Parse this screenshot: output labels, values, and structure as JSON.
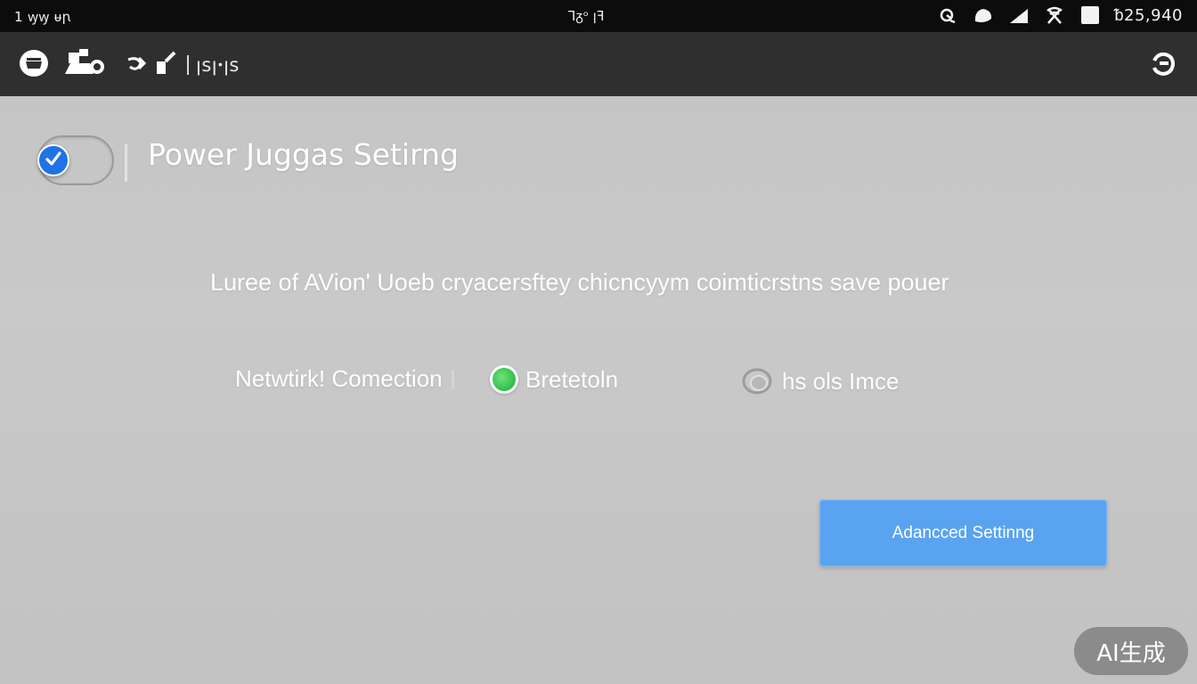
{
  "status_bar": {
    "left_text": "1 ꝡꝡ ᵾꞃ",
    "center_text": "Ꞁᵹᵒ ꞁꟻ",
    "right_value": "ᵬ25,940",
    "icons": [
      "alarm-icon",
      "chat-icon",
      "signal-icon",
      "wifi-off-icon",
      "battery-icon"
    ]
  },
  "app_bar": {
    "title": "ꞁsꞁꞏꞁs",
    "icons": [
      "home-icon",
      "profile-icon",
      "share-icon",
      "refresh-icon"
    ]
  },
  "main": {
    "toggle_checked": true,
    "title": "Power Juggas Setirng",
    "description": "Luree of AVion' Uoeb cryacersftey chicncyym coimticrstns save pouer",
    "options": {
      "network_label": "Netwtirk! Comection",
      "bluetooth_label": "Bretetoln",
      "other_label": "hs ols Imce"
    },
    "advanced_button_label": "Adancced Settinng"
  },
  "watermark": "AI生成",
  "colors": {
    "status_bg": "#0c0c0c",
    "appbar_bg": "#2f2f2f",
    "page_bg": "#c6c6c6",
    "accent_blue": "#5aa3f0",
    "toggle_blue": "#1f73e6",
    "green": "#2fbf47"
  }
}
